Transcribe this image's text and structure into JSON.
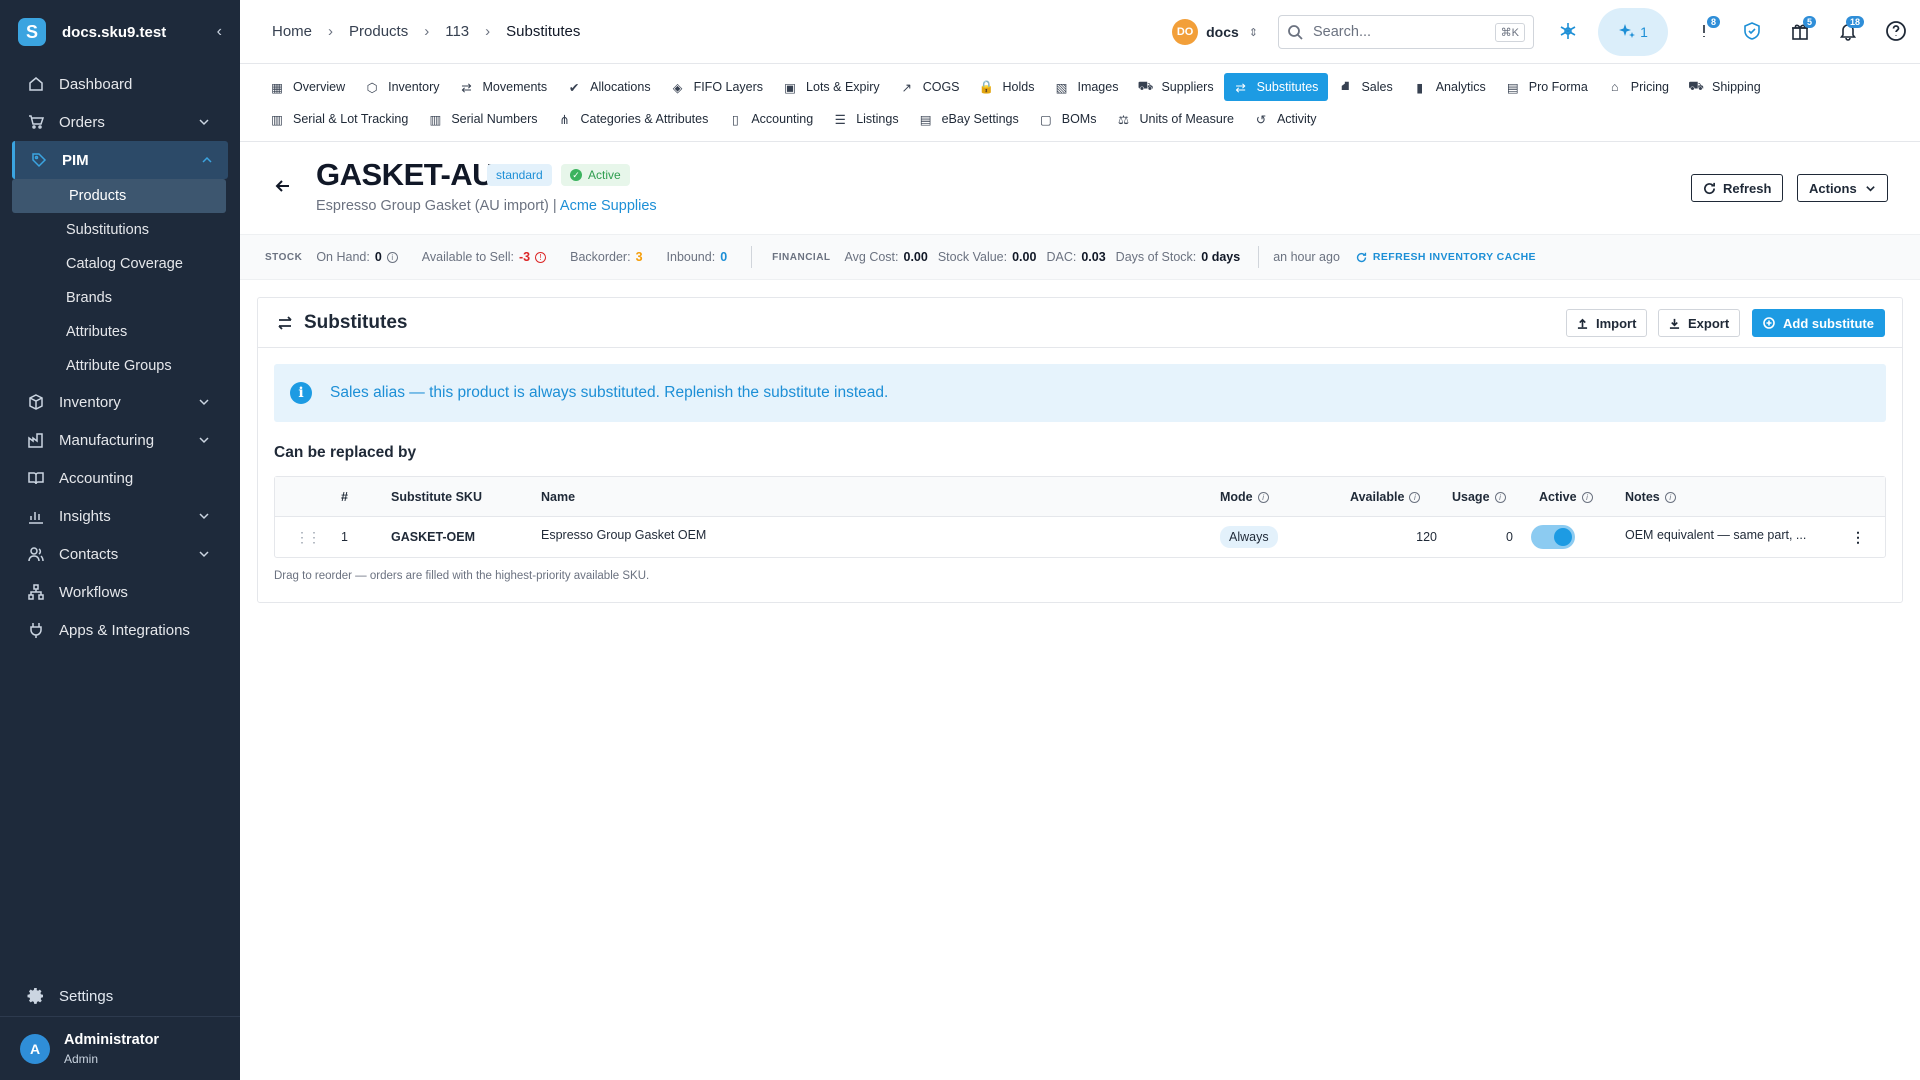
{
  "app": {
    "name": "docs.sku9.test",
    "logo_letter": "S"
  },
  "sidebar": {
    "items": [
      {
        "label": "Dashboard",
        "icon": "home-icon"
      },
      {
        "label": "Orders",
        "icon": "cart-icon"
      },
      {
        "label": "PIM",
        "icon": "tag-icon"
      },
      {
        "label": "Inventory",
        "icon": "box-icon"
      },
      {
        "label": "Manufacturing",
        "icon": "factory-icon"
      },
      {
        "label": "Accounting",
        "icon": "book-icon"
      },
      {
        "label": "Insights",
        "icon": "chart-icon"
      },
      {
        "label": "Contacts",
        "icon": "contacts-icon"
      },
      {
        "label": "Workflows",
        "icon": "workflow-icon"
      },
      {
        "label": "Apps & Integrations",
        "icon": "plug-icon"
      }
    ],
    "pim_sub": [
      "Products",
      "Substitutions",
      "Catalog Coverage",
      "Brands",
      "Attributes",
      "Attribute Groups"
    ],
    "settings": "Settings",
    "user": {
      "initial": "A",
      "name": "Administrator",
      "role": "Admin"
    }
  },
  "breadcrumb": [
    "Home",
    "Products",
    "113",
    "Substitutes"
  ],
  "topbar": {
    "org_initials": "DO",
    "org_name": "docs",
    "search_placeholder": "Search...",
    "search_shortcut": "⌘K",
    "ai_count": "1",
    "pin_badge": "8",
    "gift_badge": "5",
    "bell_badge": "18"
  },
  "tabs_row1": [
    "Overview",
    "Inventory",
    "Movements",
    "Allocations",
    "FIFO Layers",
    "Lots & Expiry",
    "COGS",
    "Holds",
    "Images",
    "Suppliers",
    "Substitutes",
    "Sales",
    "Analytics",
    "Pro Forma",
    "Pricing",
    "Shipping"
  ],
  "tabs_row2": [
    "Serial & Lot Tracking",
    "Serial Numbers",
    "Categories & Attributes",
    "Accounting",
    "Listings",
    "eBay Settings",
    "BOMs",
    "Units of Measure",
    "Activity"
  ],
  "product": {
    "sku": "GASKET-AU",
    "type": "standard",
    "status": "Active",
    "name": "Espresso Group Gasket (AU import)",
    "separator": " | ",
    "supplier": "Acme Supplies",
    "refresh_label": "Refresh",
    "actions_label": "Actions"
  },
  "stock": {
    "group_stock": "STOCK",
    "on_hand_label": "On Hand:",
    "on_hand": "0",
    "available_label": "Available to Sell:",
    "available": "-3",
    "backorder_label": "Backorder:",
    "backorder": "3",
    "inbound_label": "Inbound:",
    "inbound": "0",
    "group_financial": "FINANCIAL",
    "avg_cost_label": "Avg Cost:",
    "avg_cost": "0.00",
    "stock_value_label": "Stock Value:",
    "stock_value": "0.00",
    "dac_label": "DAC:",
    "dac": "0.03",
    "days_label": "Days of Stock:",
    "days": "0 days",
    "updated": "an hour ago",
    "refresh_cache": "REFRESH INVENTORY CACHE"
  },
  "substitutes": {
    "title": "Substitutes",
    "import": "Import",
    "export": "Export",
    "add": "Add substitute",
    "alert": "Sales alias — this product is always substituted. Replenish the substitute instead.",
    "subheading": "Can be replaced by",
    "columns": [
      "#",
      "Substitute SKU",
      "Name",
      "Mode",
      "Available",
      "Usage",
      "Active",
      "Notes"
    ],
    "rows": [
      {
        "rank": "1",
        "sku": "GASKET-OEM",
        "name": "Espresso Group Gasket OEM",
        "mode": "Always",
        "available": "120",
        "usage": "0",
        "active": true,
        "notes": "OEM equivalent — same part, ..."
      }
    ],
    "hint": "Drag to reorder — orders are filled with the highest-priority available SKU."
  },
  "colors": {
    "sidebar_bg": "#1e2a3b",
    "accent": "#1d9be3",
    "danger": "#dc2626",
    "warning": "#f59e0b"
  }
}
